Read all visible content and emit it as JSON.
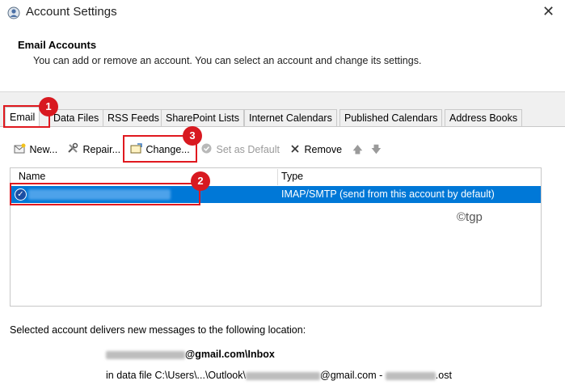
{
  "window": {
    "title": "Account Settings",
    "close_glyph": "✕"
  },
  "section": {
    "heading": "Email Accounts",
    "description": "You can add or remove an account. You can select an account and change its settings."
  },
  "tabs": [
    {
      "label": "Email",
      "active": true
    },
    {
      "label": "Data Files"
    },
    {
      "label": "RSS Feeds"
    },
    {
      "label": "SharePoint Lists"
    },
    {
      "label": "Internet Calendars"
    },
    {
      "label": "Published Calendars"
    },
    {
      "label": "Address Books"
    }
  ],
  "toolbar": {
    "new_label": "New...",
    "repair_label": "Repair...",
    "change_label": "Change...",
    "set_default_label": "Set as Default",
    "remove_label": "Remove",
    "up_glyph": "🡅",
    "down_glyph": "🡇"
  },
  "list": {
    "columns": {
      "name": "Name",
      "type": "Type"
    },
    "rows": [
      {
        "type": "IMAP/SMTP (send from this account by default)",
        "selected": true,
        "check_glyph": "✓"
      }
    ]
  },
  "watermark": "©tgp",
  "delivery": {
    "label": "Selected account delivers new messages to the following location:",
    "inbox_suffix": "@gmail.com\\Inbox",
    "datafile_prefix": "in data file C:\\Users\\...\\Outlook\\",
    "datafile_middle": "@gmail.com - ",
    "datafile_suffix": ".ost"
  },
  "annotations": {
    "step1": "1",
    "step2": "2",
    "step3": "3"
  },
  "colors": {
    "selection": "#0078d7",
    "highlight": "#e0191f"
  }
}
